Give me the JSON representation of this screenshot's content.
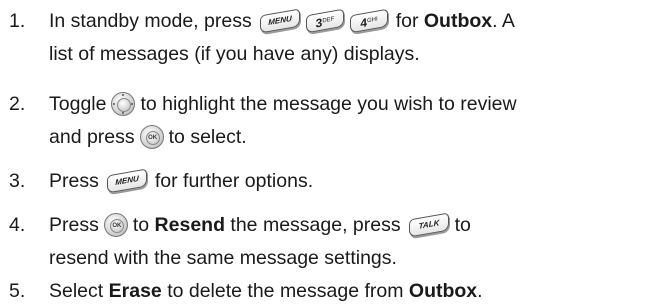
{
  "steps": [
    {
      "number": "1.",
      "lines": {
        "l1_a": "In standby mode, press",
        "l1_b": "for",
        "l1_bold": "Outbox",
        "l1_c": ". A",
        "l2": "list of messages (if you have any) displays."
      }
    },
    {
      "number": "2.",
      "lines": {
        "l1_a": "Toggle",
        "l1_b": "to highlight the message you wish to review",
        "l2_a": "and press",
        "l2_b": "to select."
      }
    },
    {
      "number": "3.",
      "lines": {
        "l1_a": "Press",
        "l1_b": "for further options."
      }
    },
    {
      "number": "4.",
      "lines": {
        "l1_a": "Press",
        "l1_b": "to",
        "l1_bold": "Resend",
        "l1_c": "the message, press",
        "l1_d": "to",
        "l2": "resend with the same message settings."
      }
    },
    {
      "number": "5.",
      "lines": {
        "l1_a": "Select",
        "l1_bold1": "Erase",
        "l1_b": "to delete the message from",
        "l1_bold2": "Outbox",
        "l1_c": "."
      }
    }
  ],
  "keys": {
    "menu": "MENU",
    "three": "3",
    "three_sub": "DEF",
    "four": "4",
    "four_sub": "GHI",
    "ok": "OK",
    "talk": "TALK"
  }
}
